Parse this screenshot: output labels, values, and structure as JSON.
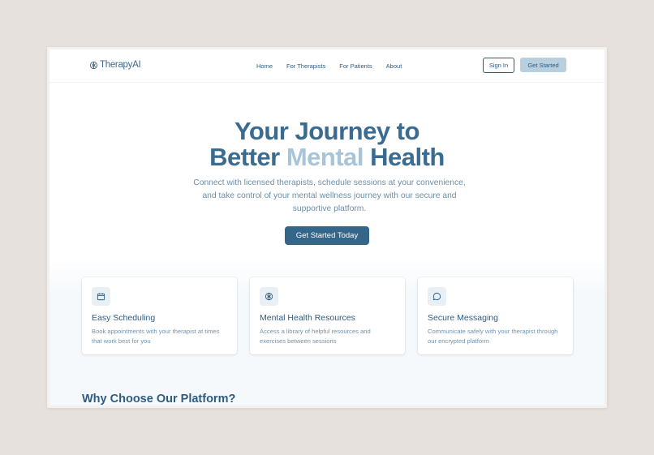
{
  "brand": {
    "name": "TherapyAI"
  },
  "nav": {
    "links": [
      "Home",
      "For Therapists",
      "For Patients",
      "About"
    ],
    "sign_in": "Sign In",
    "get_started": "Get Started"
  },
  "hero": {
    "title_line1": "Your Journey to",
    "title_line2_a": "Better ",
    "title_line2_b": "Mental",
    "title_line2_c": " Health",
    "subtitle": "Connect with licensed therapists, schedule sessions at your convenience, and take control of your mental wellness journey with our secure and supportive platform.",
    "cta": "Get Started Today"
  },
  "features": [
    {
      "icon": "calendar-icon",
      "title": "Easy Scheduling",
      "description": "Book appointments with your therapist at times that work best for you"
    },
    {
      "icon": "brain-icon",
      "title": "Mental Health Resources",
      "description": "Access a library of helpful resources and exercises between sessions"
    },
    {
      "icon": "message-icon",
      "title": "Secure Messaging",
      "description": "Communicate safely with your therapist through our encrypted platform"
    }
  ],
  "why": {
    "title": "Why Choose Our Platform?"
  },
  "colors": {
    "primary": "#336689",
    "accent_light": "#a8c4d8",
    "text_muted": "#6a8faa",
    "page_bg": "#e6e1dc"
  }
}
